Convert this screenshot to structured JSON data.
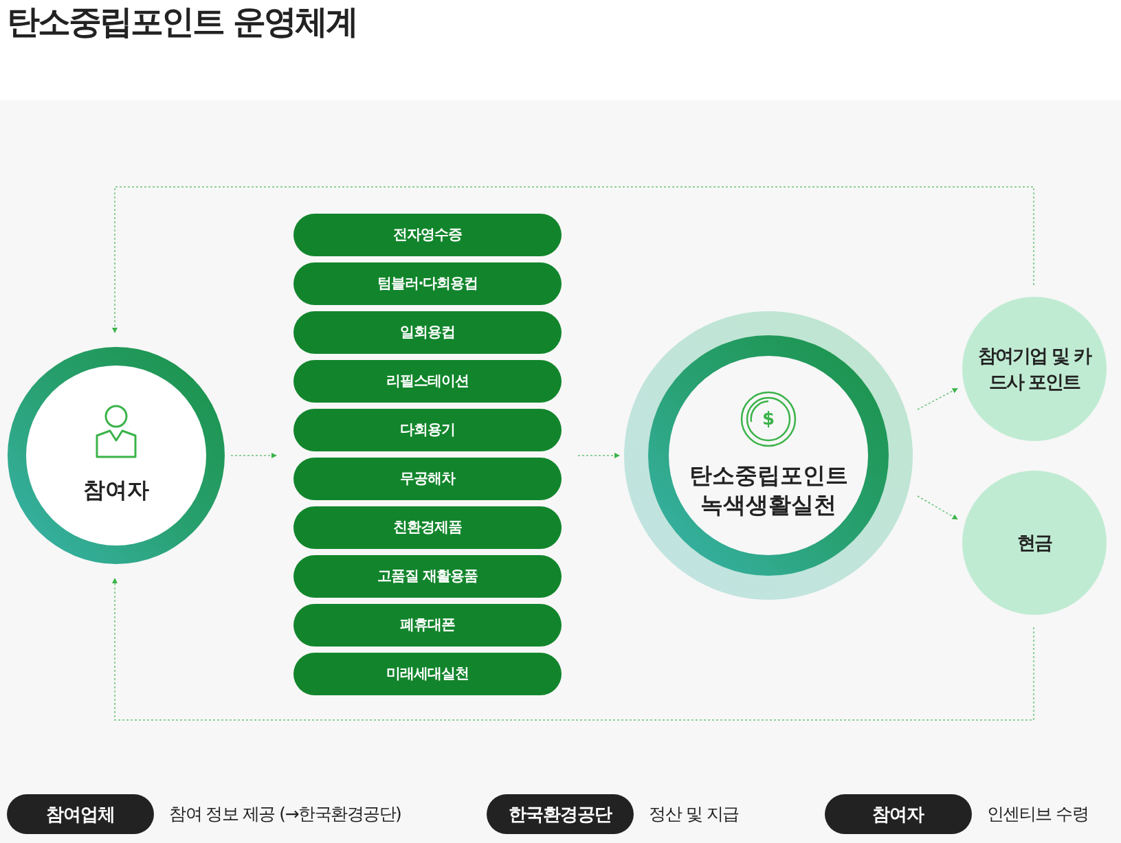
{
  "title": "탄소중립포인트 운영체계",
  "participant": {
    "label": "참여자"
  },
  "activities": [
    "전자영수증",
    "텀블러·다회용컵",
    "일회용컵",
    "리필스테이션",
    "다회용기",
    "무공해차",
    "친환경제품",
    "고품질 재활용품",
    "폐휴대폰",
    "미래세대실천"
  ],
  "center": {
    "coin_symbol": "$",
    "lines": [
      "탄소중립포인트",
      "녹색생활실천"
    ]
  },
  "rewards": [
    "참여기업 및 카드사 포인트",
    "현금"
  ],
  "legend": [
    {
      "role": "참여업체",
      "description": "참여 정보 제공 (→한국환경공단)"
    },
    {
      "role": "한국환경공단",
      "description": "정산 및 지급"
    },
    {
      "role": "참여자",
      "description": "인센티브 수령"
    }
  ]
}
